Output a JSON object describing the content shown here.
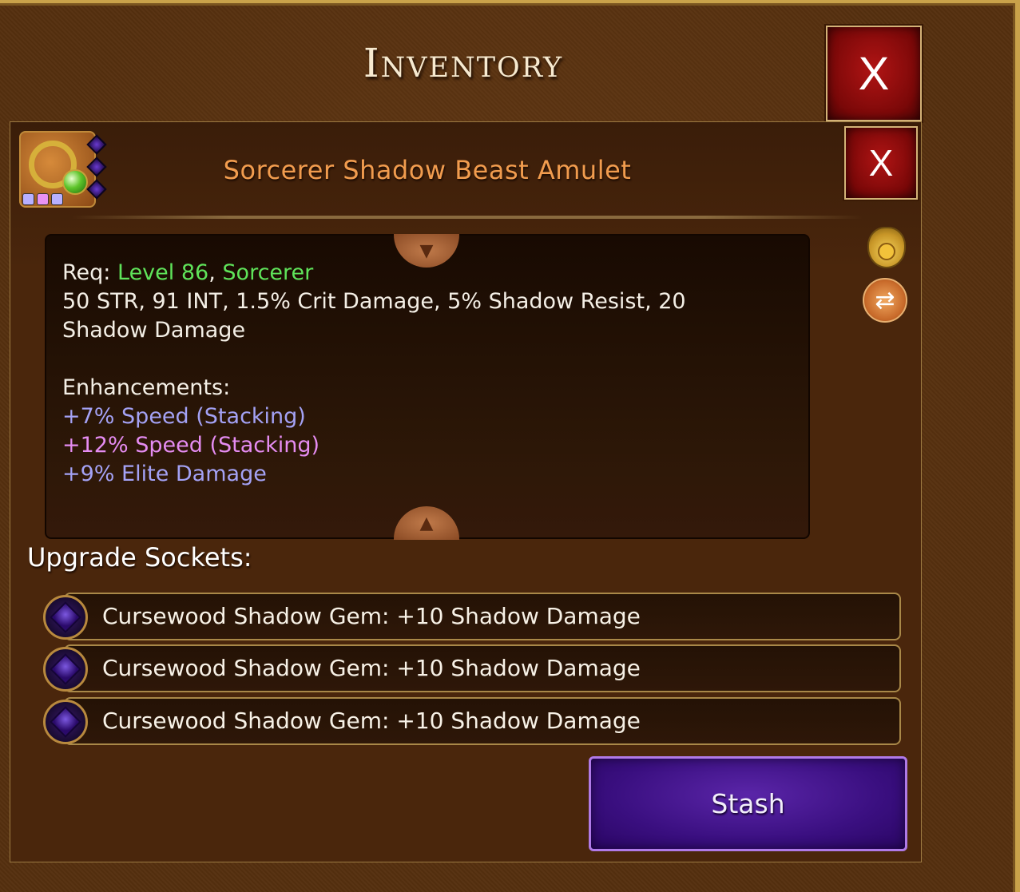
{
  "window": {
    "title": "Inventory",
    "close_label": "X"
  },
  "item": {
    "name": "Sorcerer Shadow Beast Amulet",
    "close_label": "X",
    "name_color": "#f19c4e",
    "description": {
      "req_label": "Req:",
      "req_level": "Level 86",
      "req_separator": ",",
      "req_class": "Sorcerer",
      "stats_line1": "50 STR, 91 INT, 1.5% Crit Damage, 5% Shadow Resist, 20",
      "stats_line2": "Shadow Damage",
      "enhancements_label": "Enhancements:",
      "enhancements": [
        {
          "text": "+7% Speed (Stacking)",
          "color": "#a4a2f5"
        },
        {
          "text": "+12% Speed (Stacking)",
          "color": "#e58cf2"
        },
        {
          "text": "+9% Elite Damage",
          "color": "#a4a2f5"
        }
      ]
    }
  },
  "sockets": {
    "title": "Upgrade Sockets:",
    "items": [
      {
        "label": "Cursewood Shadow Gem: +10 Shadow Damage",
        "icon": "shadow-gem-icon"
      },
      {
        "label": "Cursewood Shadow Gem: +10 Shadow Damage",
        "icon": "shadow-gem-icon"
      },
      {
        "label": "Cursewood Shadow Gem: +10 Shadow Damage",
        "icon": "shadow-gem-icon"
      }
    ]
  },
  "actions": {
    "stash_label": "Stash"
  },
  "icons": {
    "item": "amulet-icon",
    "sell": "money-bag-icon",
    "swap": "swap-icon",
    "scroll_up": "scroll-up-icon",
    "scroll_down": "scroll-down-icon"
  },
  "colors": {
    "requirement_green": "#5fe35a",
    "enhancement_lilac": "#a4a2f5",
    "enhancement_pink": "#e58cf2",
    "close_red": "#b01414",
    "stash_purple": "#3a0f80"
  }
}
